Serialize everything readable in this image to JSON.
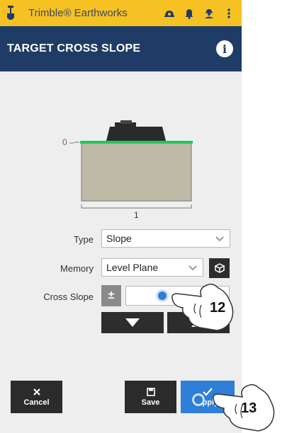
{
  "app": {
    "title": "Trimble® Earthworks"
  },
  "header": {
    "title": "TARGET CROSS SLOPE"
  },
  "diagram": {
    "left_label": "0 –",
    "bottom_label": "1"
  },
  "form": {
    "type_label": "Type",
    "type_value": "Slope",
    "memory_label": "Memory",
    "memory_value": "Level Plane",
    "cross_slope_label": "Cross Slope",
    "plus_minus": "±"
  },
  "footer": {
    "cancel_label": "Cancel",
    "save_label": "Save",
    "apply_label": "Apply"
  },
  "callouts": {
    "step_a": "12",
    "step_b": "13"
  },
  "colors": {
    "appbar": "#f6c123",
    "header": "#1f3c67",
    "accent": "#2f7ed8",
    "surface_line": "#22c55e",
    "body_gray": "#bdbaa6"
  },
  "icons": [
    "shovel-icon",
    "helmet-icon",
    "bell-icon",
    "person-icon",
    "more-vert-icon",
    "info-icon",
    "chevron-down-icon",
    "box-icon",
    "plus-minus-icon",
    "arrow-down-icon",
    "close-icon",
    "save-icon",
    "check-icon",
    "hand-pointer-icon"
  ]
}
